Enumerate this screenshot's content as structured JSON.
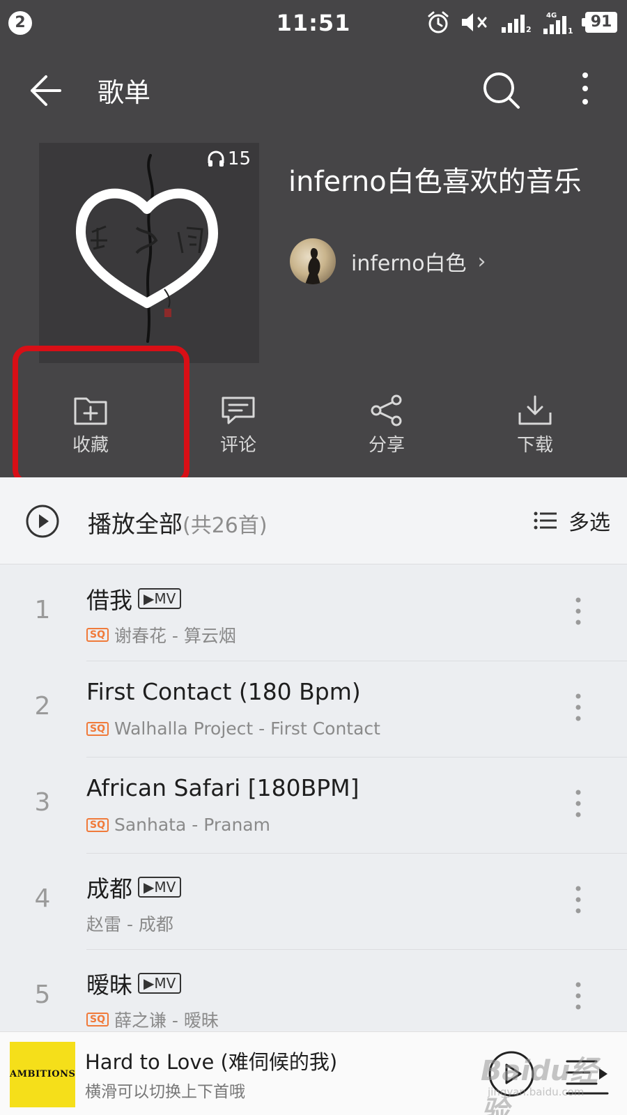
{
  "status_bar": {
    "notification_count": "2",
    "time": "11:51",
    "network": "4G",
    "battery": "91"
  },
  "header": {
    "title": "歌单",
    "icons": [
      "back-arrow-icon",
      "search-icon",
      "more-vertical-icon"
    ]
  },
  "playlist": {
    "listen_count": "15",
    "title": "inferno白色喜欢的音乐",
    "creator_name": "inferno白色",
    "creator_chevron": "›"
  },
  "actions": [
    {
      "label": "收藏",
      "icon": "add-folder-icon",
      "highlighted": true
    },
    {
      "label": "评论",
      "icon": "comment-icon"
    },
    {
      "label": "分享",
      "icon": "share-icon"
    },
    {
      "label": "下载",
      "icon": "download-icon"
    }
  ],
  "play_all": {
    "label": "播放全部",
    "count": "(共26首)",
    "multi_select": "多选"
  },
  "songs": [
    {
      "index": "1",
      "title": "借我",
      "mv": "▶MV",
      "sq": "SQ",
      "subtitle": "谢春花 - 算云烟"
    },
    {
      "index": "2",
      "title": "First Contact (180 Bpm)",
      "mv": "",
      "sq": "SQ",
      "subtitle": "Walhalla Project - First Contact"
    },
    {
      "index": "3",
      "title": "African Safari [180BPM]",
      "mv": "",
      "sq": "SQ",
      "subtitle": "Sanhata - Pranam"
    },
    {
      "index": "4",
      "title": "成都",
      "mv": "▶MV",
      "sq": "",
      "subtitle": "赵雷 - 成都"
    },
    {
      "index": "5",
      "title": "暧昧",
      "mv": "▶MV",
      "sq": "SQ",
      "subtitle": "薛之谦 - 暧昧"
    }
  ],
  "mini_player": {
    "cover_text": "AMBITIONS",
    "title": "Hard to Love (难伺候的我)",
    "subtitle": "横滑可以切换上下首哦"
  },
  "watermark": {
    "text": "Baidu经验",
    "url": "jingyan.baidu.com"
  },
  "colors": {
    "header_bg": "#464547",
    "highlight_red": "#d80f16",
    "sq_orange": "#f07a3a",
    "list_bg": "#eceef1"
  }
}
